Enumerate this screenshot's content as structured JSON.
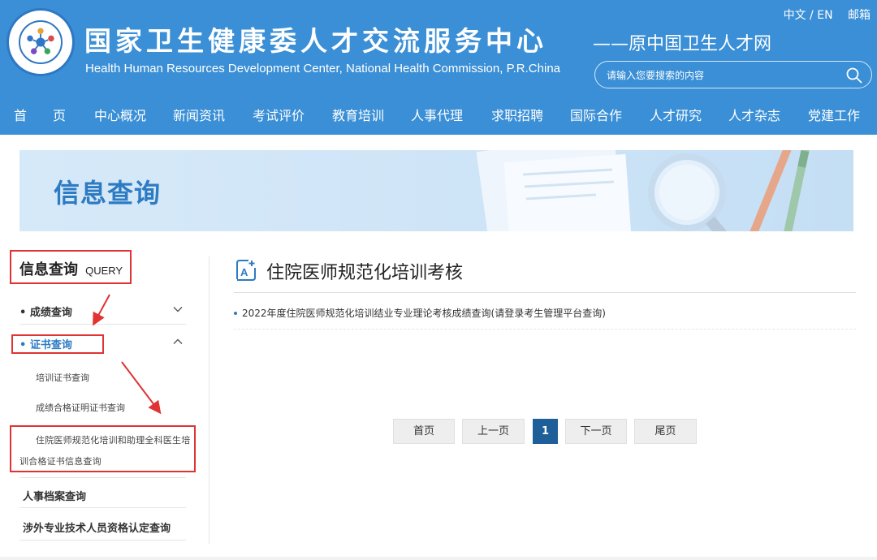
{
  "header": {
    "title_cn": "国家卫生健康委人才交流服务中心",
    "title_en": "Health Human Resources Development Center, National Health Commission, P.R.China",
    "subtitle": "——原中国卫生人才网",
    "lang_switch": "中文 / EN",
    "mail": "邮箱",
    "search_placeholder": "请输入您要搜索的内容",
    "nav": [
      "首　　页",
      "中心概况",
      "新闻资讯",
      "考试评价",
      "教育培训",
      "人事代理",
      "求职招聘",
      "国际合作",
      "人才研究",
      "人才杂志",
      "党建工作"
    ]
  },
  "banner": {
    "title": "信息查询"
  },
  "sidebar": {
    "head_cn": "信息查询",
    "head_en": "QUERY",
    "items": [
      {
        "label": "• 成绩查询",
        "expanded": false
      },
      {
        "label": "• 证书查询",
        "expanded": true
      },
      {
        "label": "人事档案查询"
      },
      {
        "label": "涉外专业技术人员资格认定查询"
      }
    ],
    "subitems": [
      "培训证书查询",
      "成绩合格证明证书查询",
      "住院医师规范化培训和助理全科医生培训合格证书信息查询"
    ]
  },
  "main": {
    "title": "住院医师规范化培训考核",
    "articles": [
      "2022年度住院医师规范化培训结业专业理论考核成绩查询(请登录考生管理平台查询)"
    ]
  },
  "pagination": {
    "first": "首页",
    "prev": "上一页",
    "current": "1",
    "next": "下一页",
    "last": "尾页"
  },
  "colors": {
    "header_bg": "#3a8fd6",
    "accent": "#2d7bc3",
    "highlight": "#e03333",
    "pager_current": "#1f5f99"
  }
}
